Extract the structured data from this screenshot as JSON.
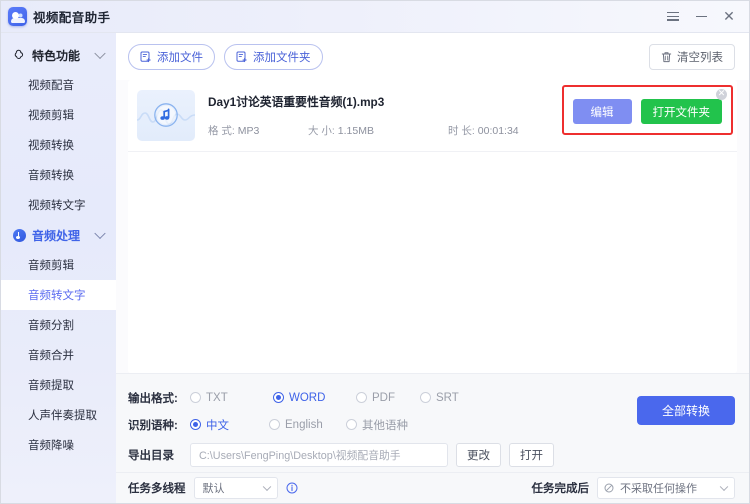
{
  "titlebar": {
    "app_title": "视频配音助手",
    "logo_icon": "app-logo-icon",
    "menu_icon": "hamburger-menu-icon",
    "minimize_icon": "minimize-icon",
    "close_icon": "close-icon"
  },
  "sidebar": {
    "groups": [
      {
        "label": "特色功能",
        "icon": "magic-wand-icon",
        "active": false,
        "items": [
          {
            "label": "视频配音",
            "selected": false
          },
          {
            "label": "视频剪辑",
            "selected": false
          },
          {
            "label": "视频转换",
            "selected": false
          },
          {
            "label": "音频转换",
            "selected": false
          },
          {
            "label": "视频转文字",
            "selected": false
          }
        ]
      },
      {
        "label": "音频处理",
        "icon": "audio-note-icon",
        "active": true,
        "items": [
          {
            "label": "音频剪辑",
            "selected": false
          },
          {
            "label": "音频转文字",
            "selected": true
          },
          {
            "label": "音频分割",
            "selected": false
          },
          {
            "label": "音频合并",
            "selected": false
          },
          {
            "label": "音频提取",
            "selected": false
          },
          {
            "label": "人声伴奏提取",
            "selected": false
          },
          {
            "label": "音频降噪",
            "selected": false
          }
        ]
      }
    ]
  },
  "toolbar": {
    "add_file_label": "添加文件",
    "add_folder_label": "添加文件夹",
    "clear_list_label": "清空列表"
  },
  "file_list": {
    "rows": [
      {
        "name": "Day1讨论英语重要性音频(1).mp3",
        "format_key": "格 式:",
        "format_value": "MP3",
        "size_key": "大 小:",
        "size_value": "1.15MB",
        "duration_key": "时 长:",
        "duration_value": "00:01:34",
        "thumbnail_icon": "audio-waveform-thumbnail",
        "edit_label": "编辑",
        "open_folder_label": "打开文件夹",
        "close_icon": "remove-row-icon"
      }
    ]
  },
  "settings": {
    "output_format": {
      "label": "输出格式:",
      "options": [
        {
          "label": "TXT",
          "selected": false
        },
        {
          "label": "WORD",
          "selected": true
        },
        {
          "label": "PDF",
          "selected": false
        },
        {
          "label": "SRT",
          "selected": false
        }
      ]
    },
    "language": {
      "label": "识别语种:",
      "options": [
        {
          "label": "中文",
          "selected": true
        },
        {
          "label": "English",
          "selected": false
        },
        {
          "label": "其他语种",
          "selected": false
        }
      ]
    },
    "export_dir": {
      "label": "导出目录",
      "value": "C:\\Users\\FengPing\\Desktop\\视频配音助手",
      "change_label": "更改",
      "open_label": "打开"
    },
    "convert_all_label": "全部转换"
  },
  "bottombar": {
    "thread_label": "任务多线程",
    "thread_value": "默认",
    "info_icon": "info-icon",
    "after_task_label": "任务完成后",
    "after_task_value": "不采取任何操作",
    "after_task_icon": "no-action-icon"
  },
  "colors": {
    "accent": "#4a68ed",
    "accent_soft": "#7f8ef2",
    "green": "#22c34c",
    "highlight_border": "#ee2f2f",
    "sidebar_bg": "#e9ecfb"
  }
}
